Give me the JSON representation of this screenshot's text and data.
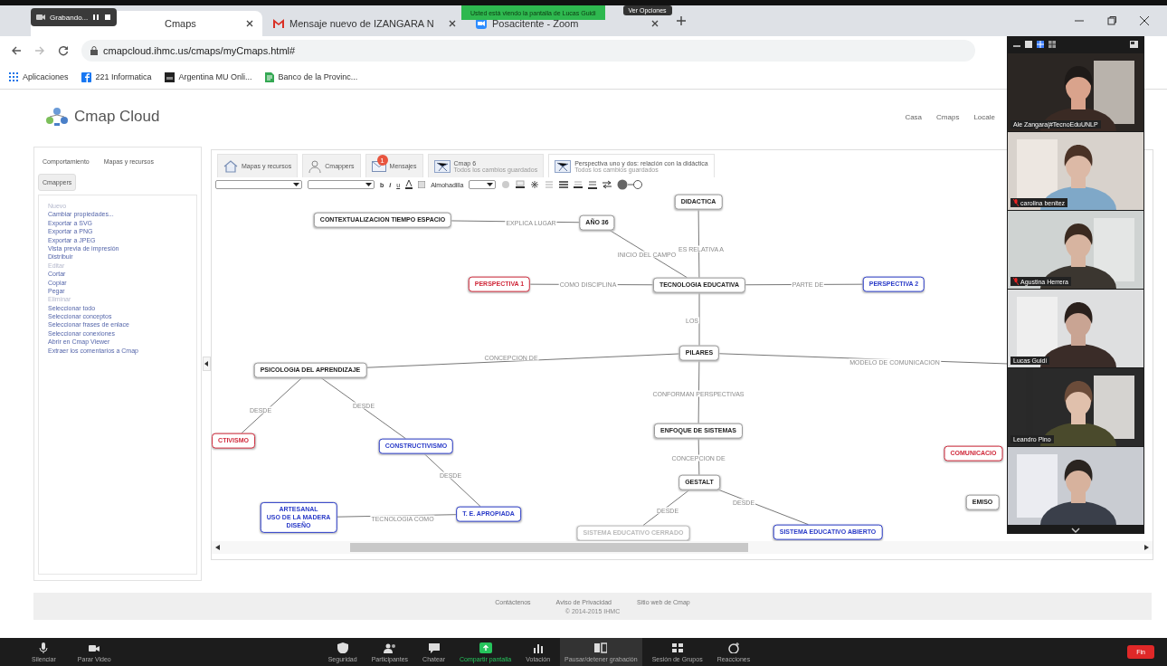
{
  "browser": {
    "recording": "Grabando...",
    "tabs": [
      {
        "title": "Cmaps",
        "selected": true
      },
      {
        "title": "Mensaje nuevo de IZANGARA N",
        "selected": false
      },
      {
        "title": "Posacitente - Zoom",
        "selected": false
      }
    ],
    "address": "cmapcloud.ihmc.us/cmaps/myCmaps.html#",
    "bookmarks": [
      "Aplicaciones",
      "221 Informatica",
      "Argentina MU Onli...",
      "Banco de la Provinc..."
    ]
  },
  "share_banner": {
    "notice": "Usted está viendo la pantalla de Lucas Guidi",
    "options": "Ver Opciones"
  },
  "site": {
    "logo": "Cmap Cloud",
    "nav": [
      "Casa",
      "Cmaps",
      "Locale"
    ]
  },
  "side_panel": {
    "tabs": [
      {
        "label": "Comportamiento",
        "selected": false
      },
      {
        "label": "Mapas y recursos",
        "selected": false
      },
      {
        "label": "Cmappers",
        "selected": true
      }
    ],
    "items": [
      {
        "label": "Nuevo",
        "disabled": true
      },
      {
        "label": "Cambiar propiedades...",
        "disabled": false
      },
      {
        "label": "Exportar a SVG",
        "disabled": false
      },
      {
        "label": "Exportar a PNG",
        "disabled": false
      },
      {
        "label": "Exportar a JPEG",
        "disabled": false
      },
      {
        "label": "Vista previa de impresión",
        "disabled": false
      },
      {
        "label": "Distribuir",
        "disabled": false
      },
      {
        "label": "Editar",
        "disabled": true
      },
      {
        "label": "Cortar",
        "disabled": false
      },
      {
        "label": "Copiar",
        "disabled": false
      },
      {
        "label": "Pegar",
        "disabled": false
      },
      {
        "label": "Eliminar",
        "disabled": true
      },
      {
        "label": "Seleccionar todo",
        "disabled": false
      },
      {
        "label": "Seleccionar conceptos",
        "disabled": false
      },
      {
        "label": "Seleccionar frases de enlace",
        "disabled": false
      },
      {
        "label": "Seleccionar conexiones",
        "disabled": false
      },
      {
        "label": "Abrir en Cmap Viewer",
        "disabled": false
      },
      {
        "label": "Extraer los comentarios a Cmap",
        "disabled": false
      }
    ]
  },
  "editor": {
    "tabs": [
      {
        "label": "Mapas y recursos",
        "kind": "home",
        "selected": false
      },
      {
        "label": "Cmappers",
        "kind": "person",
        "selected": false
      },
      {
        "label": "Mensajes",
        "kind": "mail",
        "badge": "1",
        "selected": false
      },
      {
        "label": "Cmap 6",
        "subtitle": "Todos los cambios guardados",
        "kind": "map",
        "selected": false
      },
      {
        "label": "Perspectiva uno y dos: relación con la didáctica",
        "subtitle": "Todos los cambios guardados",
        "kind": "map",
        "selected": true
      }
    ],
    "toolbar": {
      "format_buttons": [
        "b",
        "i",
        "u"
      ],
      "padding_label": "Almohadilla"
    },
    "nodes": [
      {
        "label": "DIDACTICA",
        "color": "#222222"
      },
      {
        "label": "CONTEXTUALIZACION TIEMPO ESPACIO",
        "color": "#222222"
      },
      {
        "label": "AÑO 36",
        "color": "#222222"
      },
      {
        "label": "PERSPECTIVA 1",
        "color": "#d0283a"
      },
      {
        "label": "TECNOLOGIA EDUCATIVA",
        "color": "#222222"
      },
      {
        "label": "PERSPECTIVA 2",
        "color": "#2a3bc8"
      },
      {
        "label": "PILARES",
        "color": "#222222"
      },
      {
        "label": "PSICOLOGIA DEL APRENDIZAJE",
        "color": "#222222"
      },
      {
        "label": "CTIVISMO",
        "color": "#d0283a"
      },
      {
        "label": "CONSTRUCTIVISMO",
        "color": "#2a3bc8"
      },
      {
        "label": "ENFOQUE DE SISTEMAS",
        "color": "#222222"
      },
      {
        "label": "GESTALT",
        "color": "#222222"
      },
      {
        "label": "T. E. APROPIADA",
        "color": "#2a3bc8"
      },
      {
        "label": "ARTESANAL\nUSO DE LA MADERA\nDISEÑO",
        "color": "#2a3bc8"
      },
      {
        "label": "SISTEMA EDUCATIVO CERRADO",
        "color": "#bbbbbb"
      },
      {
        "label": "SISTEMA EDUCATIVO ABIERTO",
        "color": "#2a3bc8"
      },
      {
        "label": "COMUNICACIO",
        "color": "#d0283a"
      },
      {
        "label": "EMISO",
        "color": "#222222"
      }
    ],
    "links": [
      {
        "label": "EXPLICA LUGAR"
      },
      {
        "label": "INICIO DEL CAMPO"
      },
      {
        "label": "ES RELATIVA A"
      },
      {
        "label": "COMO DISCIPLINA"
      },
      {
        "label": "PARTE DE"
      },
      {
        "label": "LOS"
      },
      {
        "label": "CONCEPCION DE"
      },
      {
        "label": "MODELO DE COMUNICACION"
      },
      {
        "label": "CONFORMAN PERSPECTIVAS"
      },
      {
        "label": "CONCEPCION DE"
      },
      {
        "label": "DESDE"
      },
      {
        "label": "DESDE"
      },
      {
        "label": "DESDE"
      },
      {
        "label": "TECNOLOGIA COMO"
      },
      {
        "label": "DESDE"
      },
      {
        "label": "DESDE"
      }
    ]
  },
  "footer": {
    "links": [
      "Contáctenos",
      "Aviso de Privacidad",
      "Sitio web de Cmap"
    ],
    "copyright": "© 2014-2015 IHMC"
  },
  "video_panel": {
    "tiles": [
      {
        "name": "Ale Zangara|#TecnoEduUNLP",
        "muted": false
      },
      {
        "name": "carolina benitez",
        "muted": true
      },
      {
        "name": "Agustina Herrera",
        "muted": true
      },
      {
        "name": "Lucas Guidi",
        "muted": false
      },
      {
        "name": "Leandro Pino",
        "muted": false
      },
      {
        "muted": false
      }
    ]
  },
  "zoom_toolbar": {
    "left": [
      {
        "label": "Silenciar",
        "kind": "mic"
      },
      {
        "label": "Parar Video",
        "kind": "camera"
      }
    ],
    "center": [
      {
        "label": "Seguridad",
        "kind": "shield",
        "selected": false
      },
      {
        "label": "Participantes",
        "kind": "people",
        "selected": false
      },
      {
        "label": "Chatear",
        "kind": "chat",
        "selected": false
      },
      {
        "label": "Compartir pantalla",
        "kind": "share",
        "selected": false
      },
      {
        "label": "Votación",
        "kind": "poll",
        "selected": false
      },
      {
        "label": "Pausar/detener grabación",
        "kind": "record",
        "selected": true
      },
      {
        "label": "Sesión de Grupos",
        "kind": "groups",
        "selected": false
      },
      {
        "label": "Reacciones",
        "kind": "react",
        "selected": false
      }
    ],
    "end": "Fin"
  }
}
